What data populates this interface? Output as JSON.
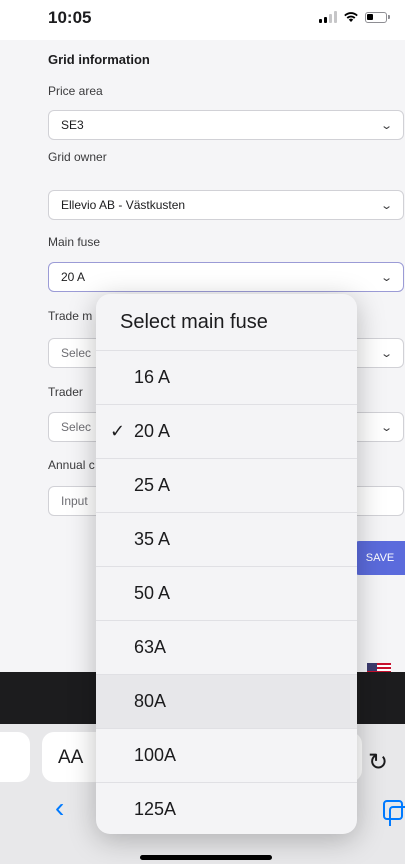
{
  "status": {
    "time": "10:05"
  },
  "form": {
    "section_title": "Grid information",
    "price_area": {
      "label": "Price area",
      "value": "SE3"
    },
    "grid_owner": {
      "label": "Grid owner",
      "value": "Ellevio AB - Västkusten"
    },
    "main_fuse": {
      "label": "Main fuse",
      "value": "20 A"
    },
    "trade_model": {
      "label": "Trade m",
      "placeholder": "Selec"
    },
    "trader": {
      "label": "Trader",
      "placeholder": "Selec"
    },
    "annual": {
      "label": "Annual c",
      "placeholder": "Input"
    },
    "save_label": "SAVE"
  },
  "picker": {
    "title": "Select main fuse",
    "selected": "20 A",
    "options": [
      "16 A",
      "20 A",
      "25 A",
      "35 A",
      "50 A",
      "63A",
      "80A",
      "100A",
      "125A"
    ]
  },
  "browser": {
    "aa_label": "AA"
  }
}
